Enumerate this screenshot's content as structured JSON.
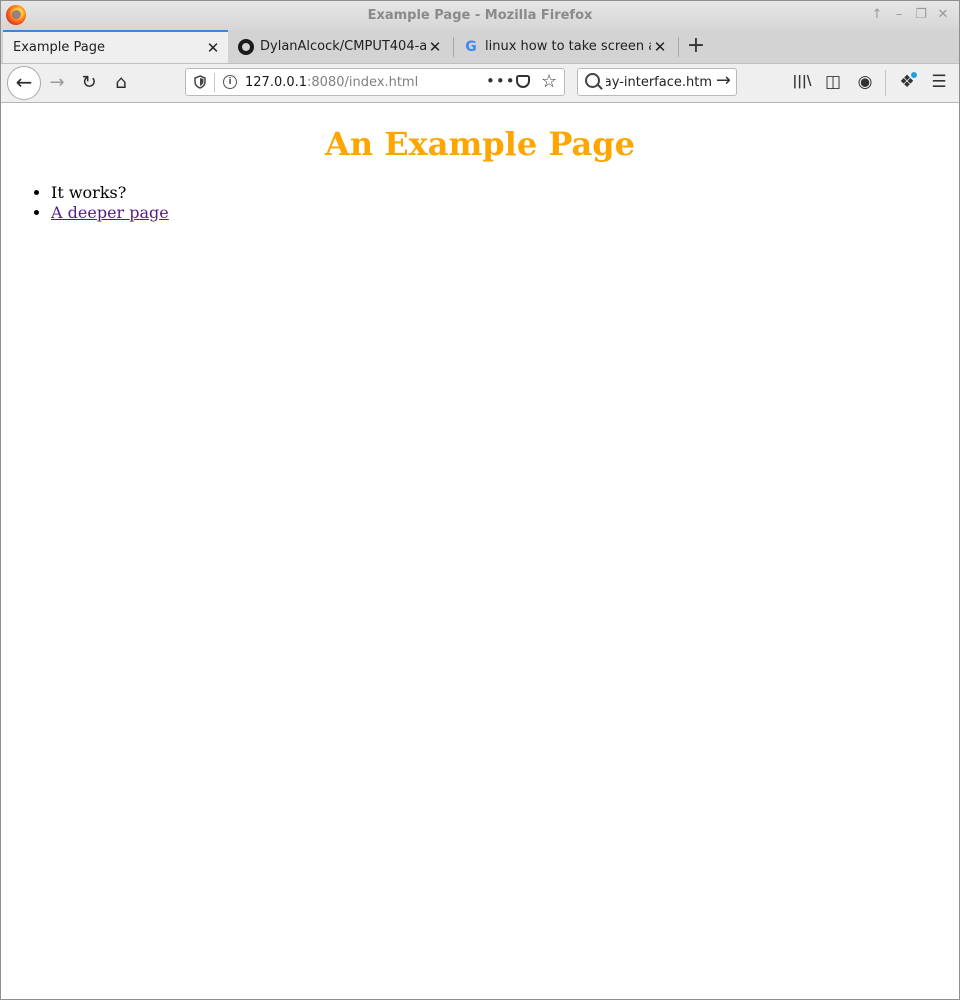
{
  "window": {
    "title": "Example Page - Mozilla Firefox",
    "controls": [
      "↑",
      "–",
      "❐",
      "✕"
    ]
  },
  "tabs": [
    {
      "label": "Example Page",
      "active": true,
      "close": "✕"
    },
    {
      "label": "DylanAlcock/CMPUT404-a",
      "active": false,
      "close": "✕",
      "icon": "github-icon"
    },
    {
      "label": "linux how to take screen a",
      "active": false,
      "close": "✕",
      "icon": "google-icon"
    }
  ],
  "new_tab": "+",
  "nav": {
    "back": "←",
    "forward": "→",
    "reload": "↻",
    "home": "⌂"
  },
  "url": {
    "host": "127.0.0.1",
    "rest": ":8080/index.html",
    "more": "•••",
    "star": "☆"
  },
  "search": {
    "value": "ay-interface.htm",
    "go": "→"
  },
  "toolbar": {
    "library": "|||\\",
    "sidebar": "◫",
    "account": "◉",
    "extensions": "❖",
    "menu": "☰"
  },
  "page": {
    "heading": "An Example Page",
    "items": [
      {
        "text": "It works?",
        "link": false
      },
      {
        "text": "A deeper page",
        "link": true
      }
    ]
  },
  "colors": {
    "heading": "#ffa500",
    "visited_link": "#551a8b",
    "active_tab_accent": "#3d86dc"
  }
}
